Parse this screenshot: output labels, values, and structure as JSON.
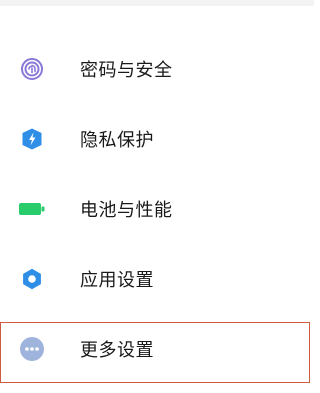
{
  "settings": {
    "items": [
      {
        "label": "密码与安全",
        "icon": "fingerprint-icon",
        "color": "#8a78d8"
      },
      {
        "label": "隐私保护",
        "icon": "privacy-shield-icon",
        "color": "#2f8fe6"
      },
      {
        "label": "电池与性能",
        "icon": "battery-icon",
        "color": "#29cc6b"
      },
      {
        "label": "应用设置",
        "icon": "gear-icon",
        "color": "#2f8fe6"
      },
      {
        "label": "更多设置",
        "icon": "more-dots-icon",
        "color": "#9fb4dd"
      }
    ]
  },
  "highlight": {
    "color": "#cf5b43"
  }
}
